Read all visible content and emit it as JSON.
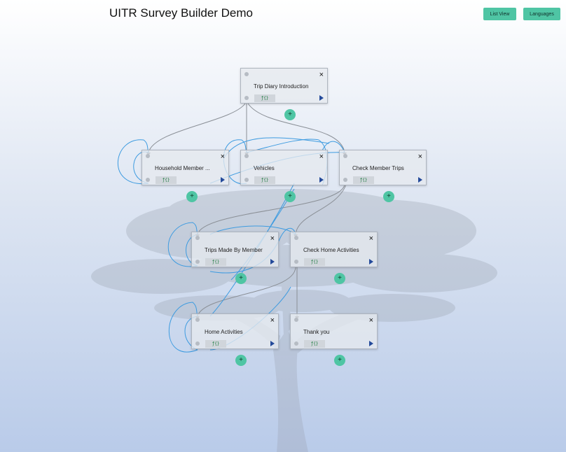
{
  "header": {
    "title": "UITR Survey Builder Demo",
    "list_view_label": "List View",
    "languages_label": "Languages"
  },
  "colors": {
    "accent": "#4fc5a4",
    "edge_gray": "#8a8f96",
    "edge_blue": "#3d9be0",
    "play": "#244a9a"
  },
  "node_icons": {
    "close": "×",
    "formula": "ƒ{}",
    "add": "+"
  },
  "nodes": [
    {
      "id": "trip-diary-intro",
      "label": "Trip Diary Introduction"
    },
    {
      "id": "household-member",
      "label": "Household Member ..."
    },
    {
      "id": "vehicles",
      "label": "Vehicles"
    },
    {
      "id": "check-member-trips",
      "label": "Check Member Trips"
    },
    {
      "id": "trips-made-by-member",
      "label": "Trips Made By Member"
    },
    {
      "id": "check-home-activities",
      "label": "Check Home Activities"
    },
    {
      "id": "home-activities",
      "label": "Home Activities"
    },
    {
      "id": "thank-you",
      "label": "Thank you"
    }
  ]
}
